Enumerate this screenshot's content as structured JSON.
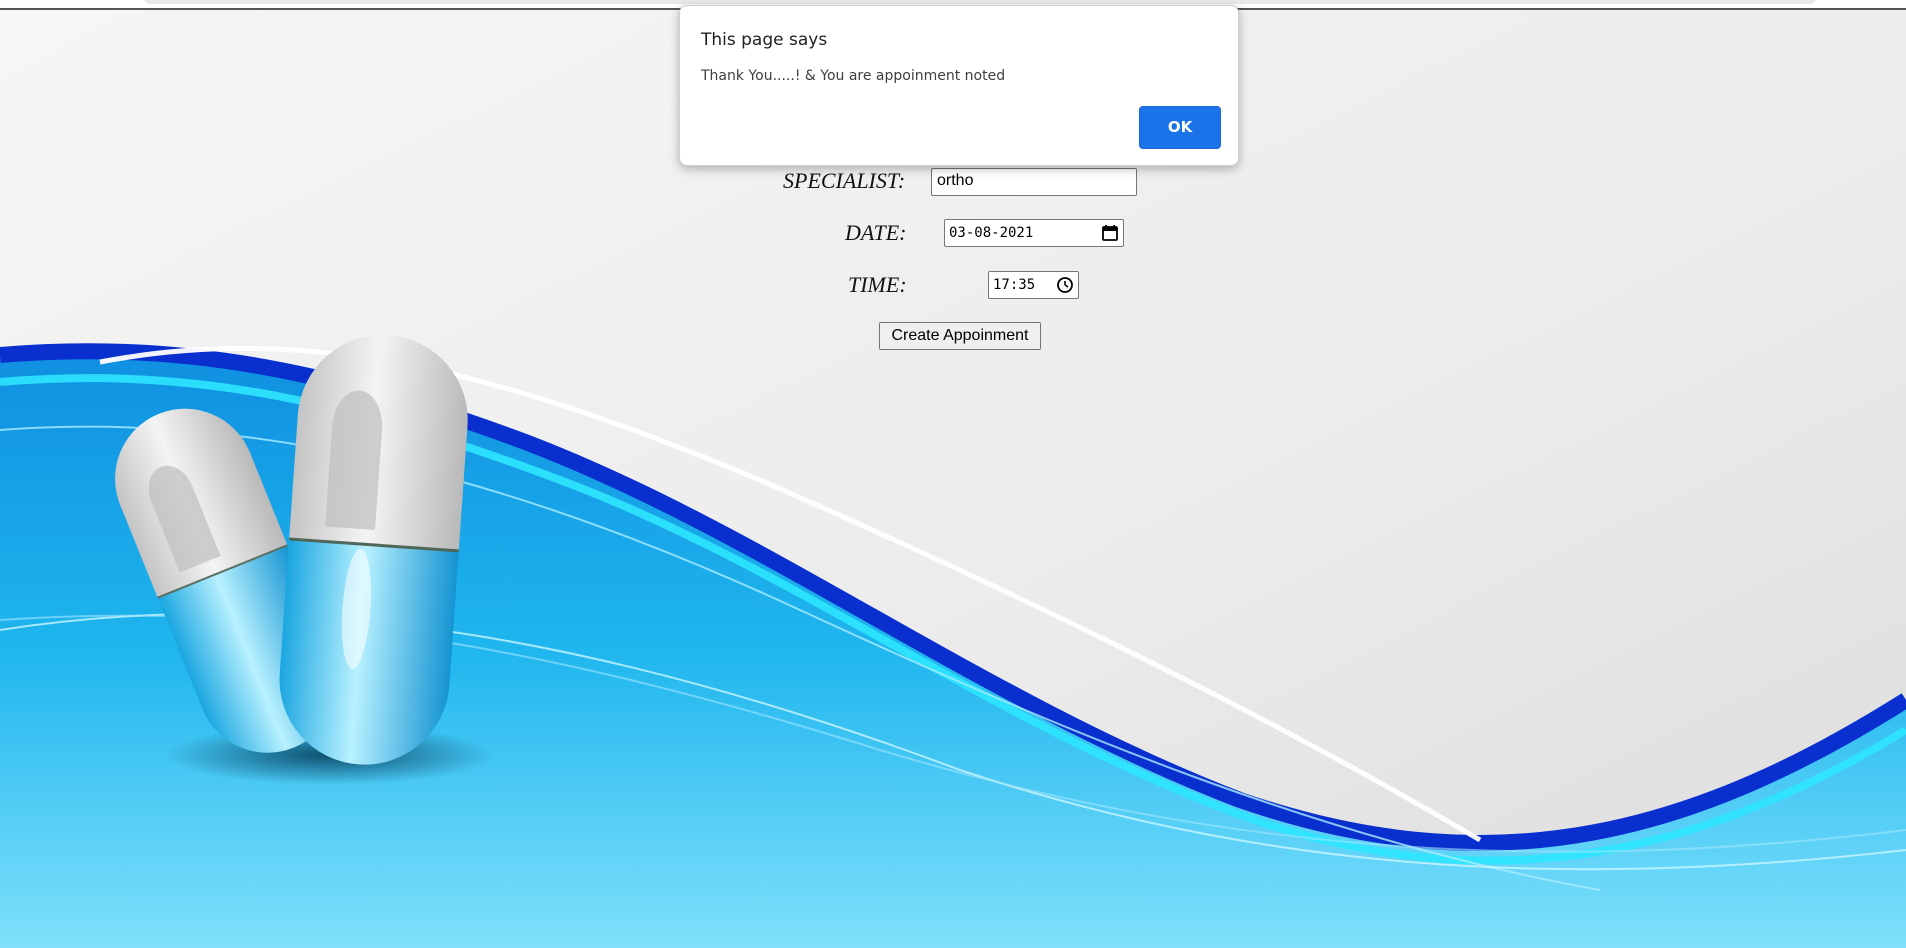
{
  "form": {
    "specialist_label": "SPECIALIST:",
    "specialist_value": "ortho",
    "date_label": "DATE:",
    "date_value": "03-08-2021",
    "time_label": "TIME:",
    "time_value": "17:35",
    "submit_label": "Create Appoinment"
  },
  "dialog": {
    "title": "This page says",
    "message": "Thank You.....! & You are appoinment noted",
    "ok_label": "OK"
  },
  "colors": {
    "accent_blue": "#1a73e8",
    "wave_deep_blue": "#0a2fcf",
    "wave_cyan": "#20c8f0",
    "background_grey": "#ececec"
  },
  "icons": {
    "date_picker": "calendar-icon",
    "time_picker": "clock-icon"
  }
}
